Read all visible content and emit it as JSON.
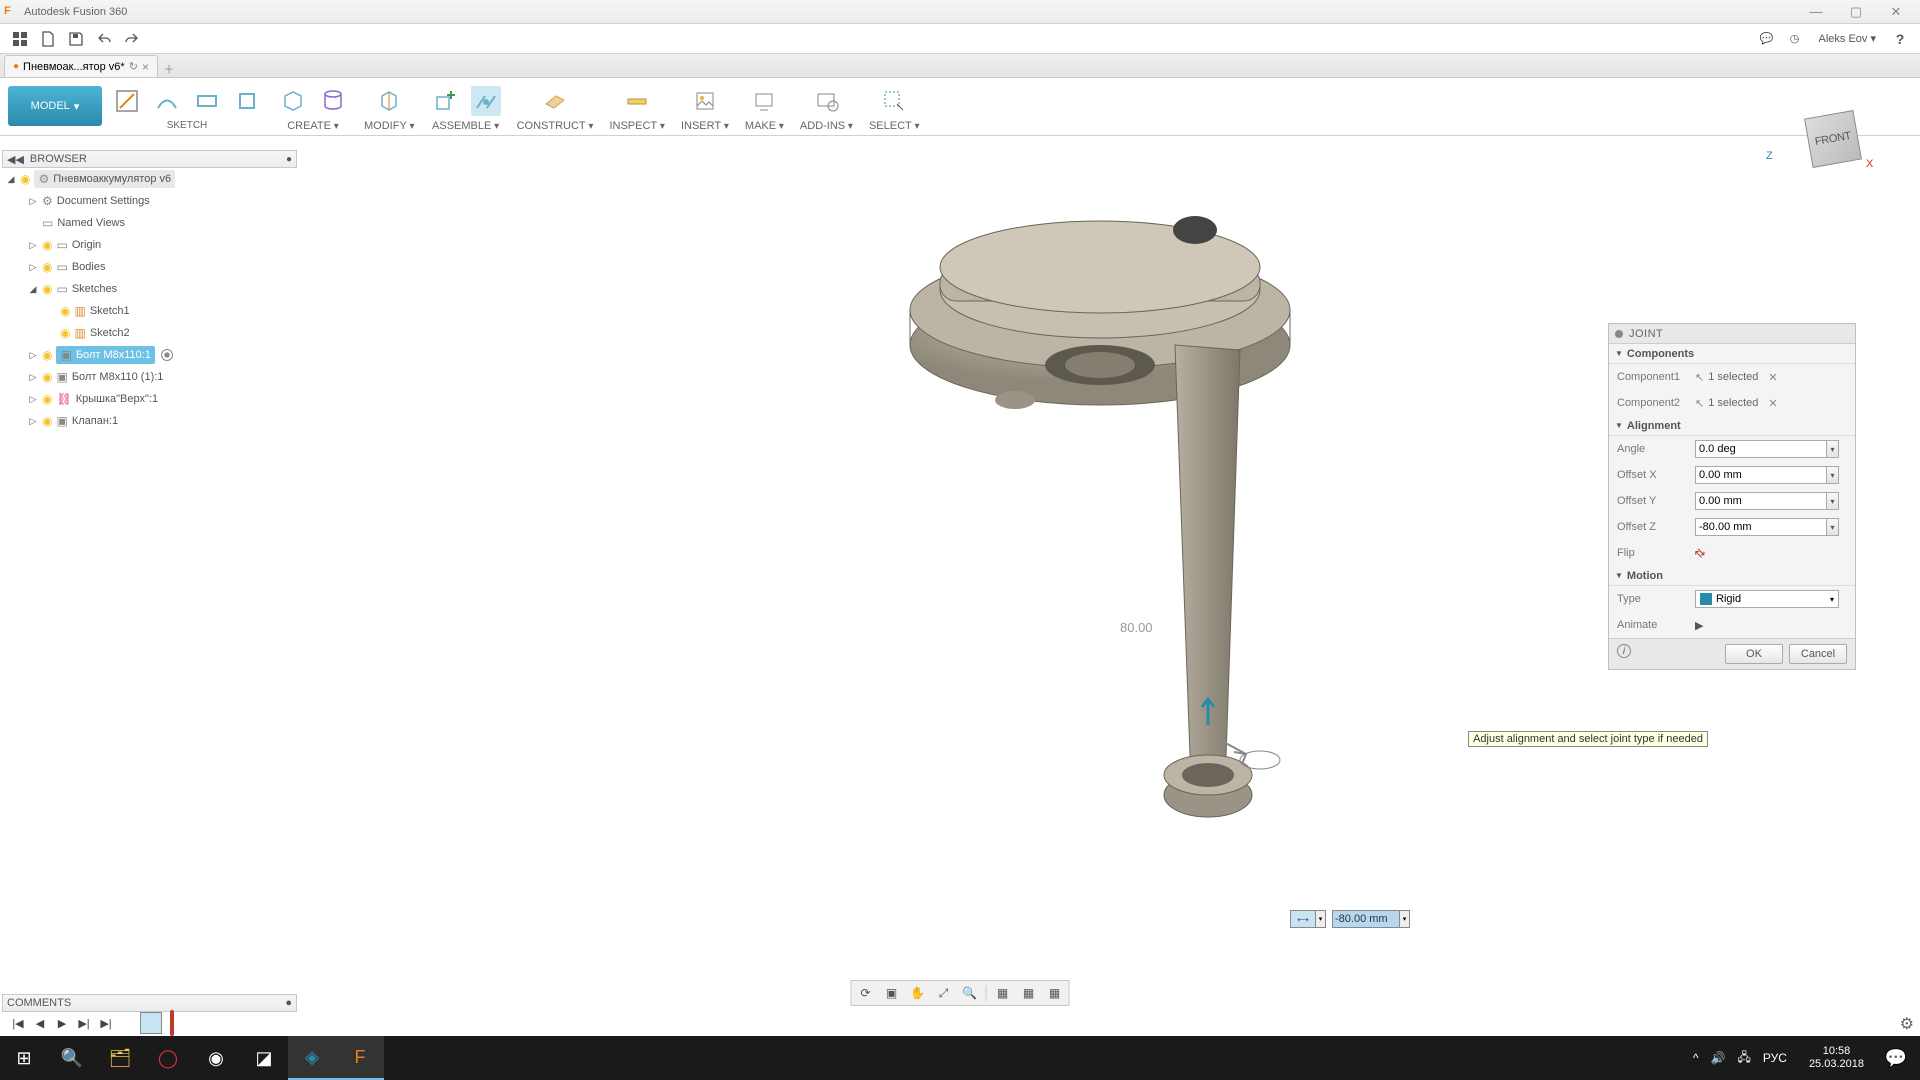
{
  "app": {
    "title": "Autodesk Fusion 360",
    "user": "Aleks Eov"
  },
  "doctab": {
    "name": "Пневмоак...ятор v6*"
  },
  "ribbon": {
    "model_label": "MODEL",
    "groups": [
      "SKETCH",
      "CREATE",
      "MODIFY",
      "ASSEMBLE",
      "CONSTRUCT",
      "INSPECT",
      "INSERT",
      "MAKE",
      "ADD-INS",
      "SELECT"
    ]
  },
  "browser": {
    "header": "BROWSER",
    "root": "Пневмоаккумулятор v6",
    "items": [
      {
        "label": "Document Settings",
        "expand": "▷",
        "icon": "gear"
      },
      {
        "label": "Named Views",
        "expand": "",
        "icon": "folder"
      },
      {
        "label": "Origin",
        "expand": "▷",
        "icon": "origin"
      },
      {
        "label": "Bodies",
        "expand": "▷",
        "icon": "folder"
      },
      {
        "label": "Sketches",
        "expand": "◢",
        "icon": "folder"
      }
    ],
    "sketches": [
      "Sketch1",
      "Sketch2"
    ],
    "components": [
      {
        "label": "Болт М8х110:1",
        "selected": true
      },
      {
        "label": "Болт М8х110 (1):1",
        "selected": false
      },
      {
        "label": "Крышка\"Верх\":1",
        "selected": false
      },
      {
        "label": "Клапан:1",
        "selected": false
      }
    ]
  },
  "joint": {
    "title": "JOINT",
    "sec_components": "Components",
    "comp1_lbl": "Component1",
    "comp1_val": "1 selected",
    "comp2_lbl": "Component2",
    "comp2_val": "1 selected",
    "sec_alignment": "Alignment",
    "angle_lbl": "Angle",
    "angle_val": "0.0 deg",
    "ox_lbl": "Offset X",
    "ox_val": "0.00 mm",
    "oy_lbl": "Offset Y",
    "oy_val": "0.00 mm",
    "oz_lbl": "Offset Z",
    "oz_val": "-80.00 mm",
    "flip_lbl": "Flip",
    "sec_motion": "Motion",
    "type_lbl": "Type",
    "type_val": "Rigid",
    "anim_lbl": "Animate",
    "ok": "OK",
    "cancel": "Cancel",
    "hint": "Adjust alignment and select joint type if needed"
  },
  "viewcube": {
    "face": "FRONT",
    "z": "Z",
    "x": "X"
  },
  "canvas": {
    "dim": "80.00",
    "inline_val": "-80.00 mm"
  },
  "comments": {
    "header": "COMMENTS"
  },
  "taskbar": {
    "time": "10:58",
    "date": "25.03.2018",
    "lang": "РУС"
  }
}
